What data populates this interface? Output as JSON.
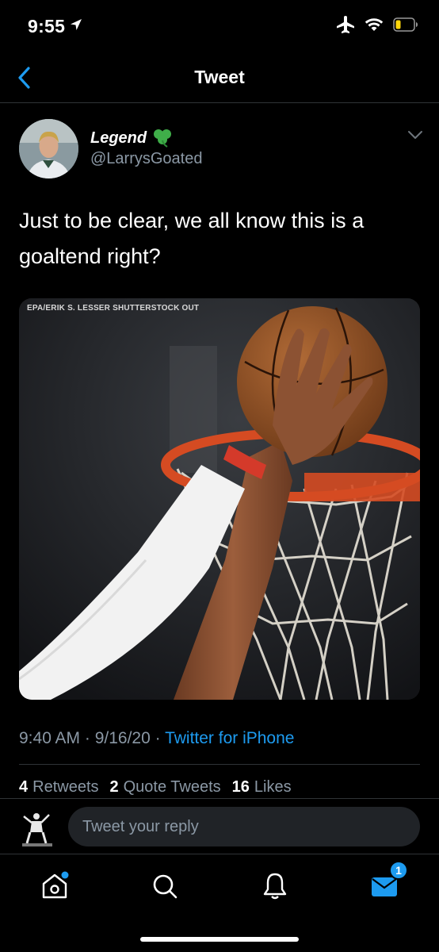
{
  "status_bar": {
    "time": "9:55"
  },
  "nav": {
    "title": "Tweet"
  },
  "tweet": {
    "display_name": "Legend",
    "handle": "@LarrysGoated",
    "text": "Just to be clear, we all know this is a goaltend right?",
    "media_credit": "EPA/ERIK S. LESSER SHUTTERSTOCK OUT",
    "timestamp": "9:40 AM · 9/16/20 · ",
    "source": "Twitter for iPhone"
  },
  "stats": {
    "retweets_count": "4",
    "retweets_label": "Retweets",
    "quotes_count": "2",
    "quotes_label": "Quote Tweets",
    "likes_count": "16",
    "likes_label": "Likes"
  },
  "reply": {
    "placeholder": "Tweet your reply"
  },
  "tab_bar": {
    "messages_badge": "1"
  },
  "colors": {
    "accent": "#1d9bf0",
    "secondary_text": "#8b98a5",
    "divider": "#2f3336"
  },
  "icons": [
    "back-icon",
    "location-arrow-icon",
    "airplane-icon",
    "wifi-icon",
    "battery-icon",
    "clover-icon",
    "chevron-down-icon",
    "home-icon",
    "search-icon",
    "bell-icon",
    "mail-icon"
  ]
}
